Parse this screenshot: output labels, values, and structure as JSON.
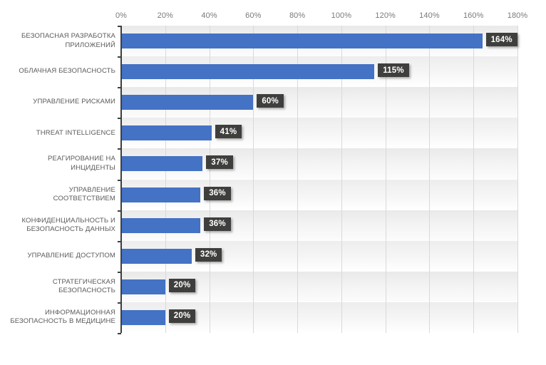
{
  "chart_data": {
    "type": "bar",
    "orientation": "horizontal",
    "title": "",
    "subtitle": "",
    "xlabel": "",
    "ylabel": "",
    "xlim": [
      0,
      180
    ],
    "x_tick_labels": [
      "0%",
      "20%",
      "40%",
      "60%",
      "80%",
      "100%",
      "120%",
      "140%",
      "160%",
      "180%"
    ],
    "x_tick_values": [
      0,
      20,
      40,
      60,
      80,
      100,
      120,
      140,
      160,
      180
    ],
    "grid": true,
    "legend": false,
    "value_suffix": "%",
    "categories": [
      "БЕЗОПАСНАЯ РАЗРАБОТКА ПРИЛОЖЕНИЙ",
      "ОБЛАЧНАЯ БЕЗОПАСНОСТЬ",
      "УПРАВЛЕНИЕ РИСКАМИ",
      "THREAT INTELLIGENCE",
      "РЕАГИРОВАНИЕ НА ИНЦИДЕНТЫ",
      "УПРАВЛЕНИЕ СООТВЕТСТВИЕМ",
      "КОНФИДЕНЦИАЛЬНОСТЬ И БЕЗОПАСНОСТЬ ДАННЫХ",
      "УПРАВЛЕНИЕ ДОСТУПОМ",
      "СТРАТЕГИЧЕСКАЯ БЕЗОПАСНОСТЬ",
      "ИНФОРМАЦИОННАЯ БЕЗОПАСНОСТЬ В МЕДИЦИНЕ"
    ],
    "category_lines": [
      [
        "БЕЗОПАСНАЯ РАЗРАБОТКА",
        "ПРИЛОЖЕНИЙ"
      ],
      [
        "ОБЛАЧНАЯ БЕЗОПАСНОСТЬ"
      ],
      [
        "УПРАВЛЕНИЕ РИСКАМИ"
      ],
      [
        "THREAT INTELLIGENCE"
      ],
      [
        "РЕАГИРОВАНИЕ НА",
        "ИНЦИДЕНТЫ"
      ],
      [
        "УПРАВЛЕНИЕ",
        "СООТВЕТСТВИЕМ"
      ],
      [
        "КОНФИДЕНЦИАЛЬНОСТЬ И",
        "БЕЗОПАСНОСТЬ ДАННЫХ"
      ],
      [
        "УПРАВЛЕНИЕ ДОСТУПОМ"
      ],
      [
        "СТРАТЕГИЧЕСКАЯ",
        "БЕЗОПАСНОСТЬ"
      ],
      [
        "ИНФОРМАЦИОННАЯ",
        "БЕЗОПАСНОСТЬ В МЕДИЦИНЕ"
      ]
    ],
    "values": [
      164,
      115,
      60,
      41,
      37,
      36,
      36,
      32,
      20,
      20
    ],
    "data_labels": [
      "164%",
      "115%",
      "60%",
      "41%",
      "37%",
      "36%",
      "36%",
      "32%",
      "20%",
      "20%"
    ],
    "series": [
      {
        "name": "",
        "values": [
          164,
          115,
          60,
          41,
          37,
          36,
          36,
          32,
          20,
          20
        ]
      }
    ]
  },
  "colors": {
    "bar": "#4472C4",
    "data_label_background": "#3B3B39",
    "data_label_text": "#FFFFFF",
    "axis_line": "#3F3F3F",
    "gridline": "#D9D9D9",
    "tick_label_text": "#7A7A7A",
    "category_label_text": "#5A5A5A",
    "plot_background": "#FFFFFF",
    "band_background": "#EFEFEF"
  }
}
